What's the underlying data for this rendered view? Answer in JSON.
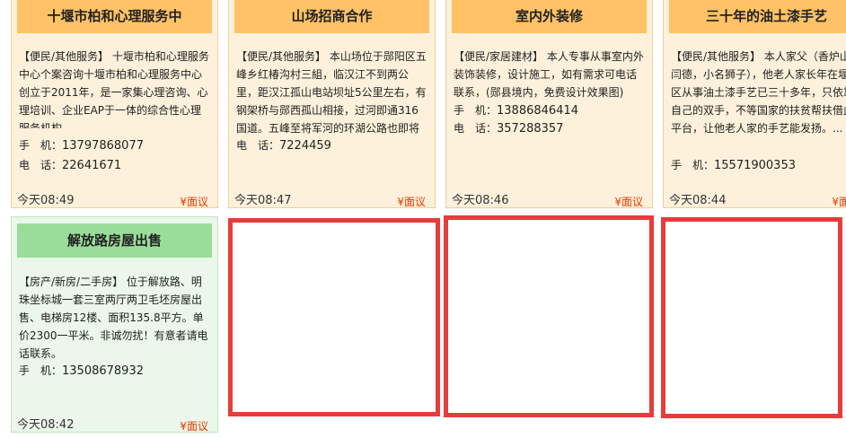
{
  "cards": [
    {
      "title": "十堰市柏和心理服务中",
      "description": "【便民/其他服务】 十堰市柏和心理服务中心个案咨询十堰市柏和心理服务中心创立于2011年，是一家集心理咨询、心理培训、企业EAP于一体的综合性心理服务机构...",
      "phones": [
        {
          "label": "手　机：",
          "value": "13797868077"
        },
        {
          "label": "电　话：",
          "value": "22641671"
        }
      ],
      "time": "今天08:49",
      "price": "¥面议"
    },
    {
      "title": "山场招商合作",
      "description": "【便民/其他服务】 本山场位于郧阳区五峰乡红椿沟村三組，临汉江不到两公里，距汉江孤山电站坝址5公里左右，有钢架桥与郧西孤山相接，过河即通316国道。五峰至将军河的环湖公路也即将开建，...",
      "phones": [
        {
          "label": "电　话：",
          "value": "7224459"
        }
      ],
      "time": "今天08:47",
      "price": "¥面议"
    },
    {
      "title": "室内外装修",
      "description": "【便民/家居建材】 本人专事从事室内外装饰装修，设计施工，如有需求可电话联系，(郧县境内，免费设计效果图)",
      "phones": [
        {
          "label": "手　机：",
          "value": "13886846414"
        },
        {
          "label": "电　话：",
          "value": "357288357"
        }
      ],
      "time": "今天08:46",
      "price": "¥面议"
    },
    {
      "title": "三十年的油土漆手艺",
      "description": "【便民/其他服务】 本人家父（香炉山的闫德，小名狮子），他老人家长年在堰地区从事油土漆手艺已三十多年，只依靠自己的双手，不等国家的扶贫帮扶借此平台，让他老人家的手艺能发扬。...",
      "phones": [
        {
          "label": "手　机：",
          "value": "15571900353"
        }
      ],
      "time": "今天08:44",
      "price": "¥面议"
    },
    {
      "title": "解放路房屋出售",
      "description": "【房产/新房/二手房】 位于解放路、明珠坐标城一套三室两厅两卫毛坯房屋出售、电梯房12楼、面积135.8平方。单价2300一平米。非诚勿扰！有意者请电话联系。",
      "phones": [
        {
          "label": "手　机：",
          "value": "13508678932"
        }
      ],
      "time": "今天08:42",
      "price": "¥面议"
    }
  ]
}
